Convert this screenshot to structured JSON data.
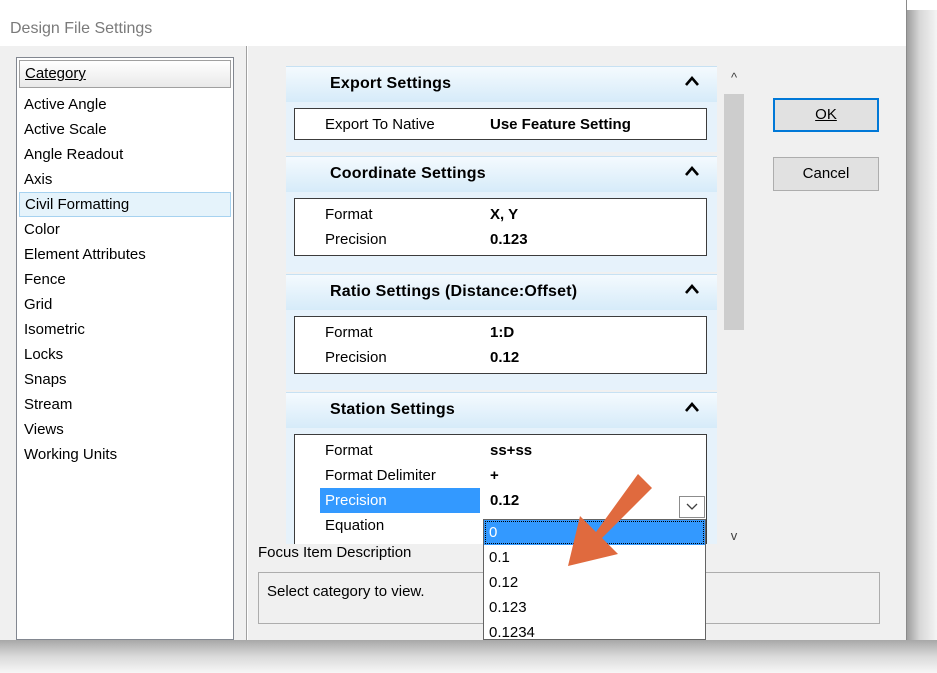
{
  "window": {
    "title": "Design File Settings"
  },
  "categories": {
    "header": "Category",
    "items": [
      "Active Angle",
      "Active Scale",
      "Angle Readout",
      "Axis",
      "Civil Formatting",
      "Color",
      "Element Attributes",
      "Fence",
      "Grid",
      "Isometric",
      "Locks",
      "Snaps",
      "Stream",
      "Views",
      "Working Units"
    ],
    "selected": "Civil Formatting"
  },
  "sections": {
    "export": {
      "title": "Export Settings",
      "rows": [
        {
          "key": "Export To Native",
          "value": "Use Feature Setting"
        }
      ]
    },
    "coordinate": {
      "title": "Coordinate Settings",
      "rows": [
        {
          "key": "Format",
          "value": "X, Y"
        },
        {
          "key": "Precision",
          "value": "0.123"
        }
      ]
    },
    "ratio": {
      "title": "Ratio Settings (Distance:Offset)",
      "rows": [
        {
          "key": "Format",
          "value": "1:D"
        },
        {
          "key": "Precision",
          "value": "0.12"
        }
      ]
    },
    "station": {
      "title": "Station Settings",
      "rows": [
        {
          "key": "Format",
          "value": "ss+ss"
        },
        {
          "key": "Format Delimiter",
          "value": "+"
        },
        {
          "key": "Precision",
          "value": "0.12"
        },
        {
          "key": "Equation",
          "value": ""
        }
      ]
    }
  },
  "chevron": "^",
  "scroll": {
    "up": "^",
    "down": "v"
  },
  "buttons": {
    "ok": "OK",
    "cancel": "Cancel"
  },
  "focus": {
    "label": "Focus Item Description",
    "text": "Select category to view."
  },
  "precision_dropdown": {
    "options": [
      "0",
      "0.1",
      "0.12",
      "0.123",
      "0.1234"
    ],
    "selected": "0"
  },
  "colors": {
    "selection": "#3399ff",
    "section_header": "#d6ebf9",
    "annotation_arrow": "#e06a3e",
    "ok_border": "#0078d7"
  }
}
